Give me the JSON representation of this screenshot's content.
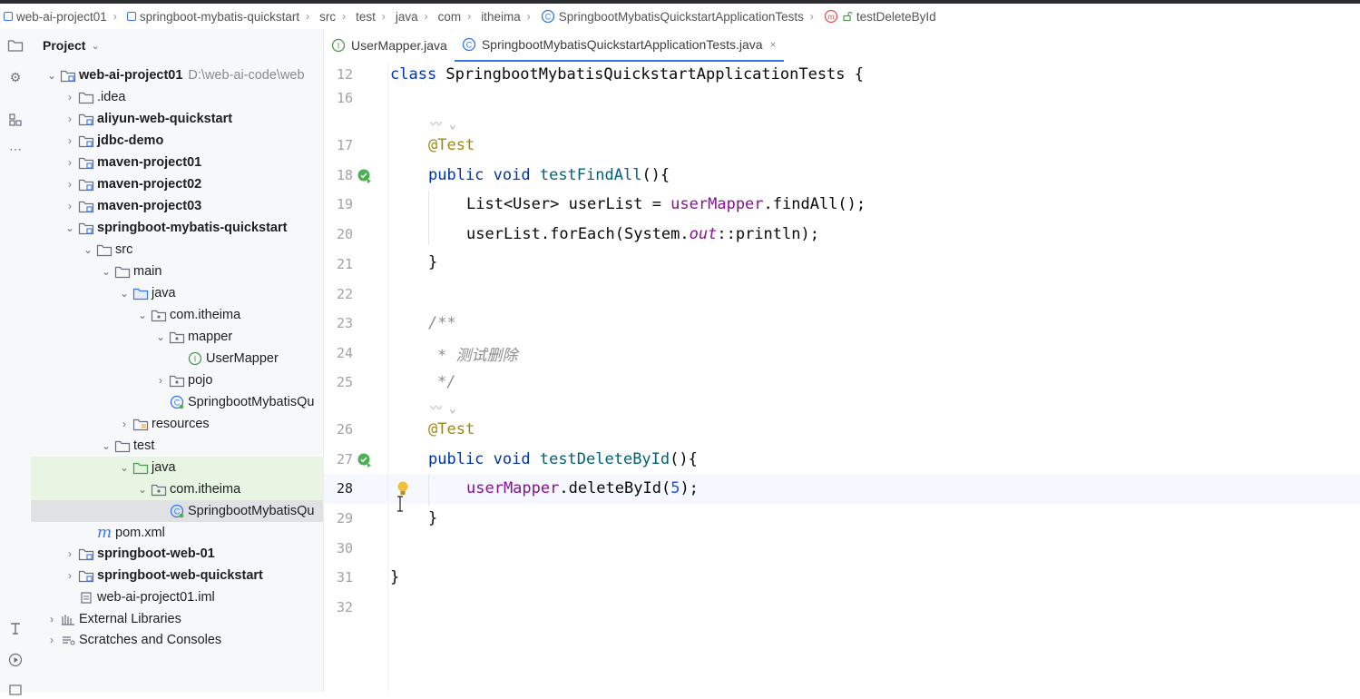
{
  "breadcrumb": [
    {
      "label": "web-ai-project01",
      "icon": "module-icon"
    },
    {
      "label": "springboot-mybatis-quickstart",
      "icon": "module-icon"
    },
    {
      "label": "src"
    },
    {
      "label": "test"
    },
    {
      "label": "java"
    },
    {
      "label": "com"
    },
    {
      "label": "itheima"
    },
    {
      "label": "SpringbootMybatisQuickstartApplicationTests",
      "icon": "class-icon"
    },
    {
      "label": "testDeleteById",
      "icon": "method-icon"
    }
  ],
  "panel": {
    "title": "Project"
  },
  "tree": [
    {
      "label": "web-ai-project01",
      "path": "D:\\web-ai-code\\web",
      "bold": true
    },
    {
      "label": ".idea"
    },
    {
      "label": "aliyun-web-quickstart",
      "bold": true
    },
    {
      "label": "jdbc-demo",
      "bold": true
    },
    {
      "label": "maven-project01",
      "bold": true
    },
    {
      "label": "maven-project02",
      "bold": true
    },
    {
      "label": "maven-project03",
      "bold": true
    },
    {
      "label": "springboot-mybatis-quickstart",
      "bold": true
    },
    {
      "label": "src"
    },
    {
      "label": "main"
    },
    {
      "label": "java"
    },
    {
      "label": "com.itheima"
    },
    {
      "label": "mapper"
    },
    {
      "label": "UserMapper"
    },
    {
      "label": "pojo"
    },
    {
      "label": "SpringbootMybatisQu"
    },
    {
      "label": "resources"
    },
    {
      "label": "test"
    },
    {
      "label": "java"
    },
    {
      "label": "com.itheima"
    },
    {
      "label": "SpringbootMybatisQu"
    },
    {
      "label": "pom.xml"
    },
    {
      "label": "springboot-web-01",
      "bold": true
    },
    {
      "label": "springboot-web-quickstart",
      "bold": true
    },
    {
      "label": "web-ai-project01.iml"
    },
    {
      "label": "External Libraries"
    },
    {
      "label": "Scratches and Consoles"
    }
  ],
  "tabs": [
    {
      "label": "UserMapper.java",
      "active": false
    },
    {
      "label": "SpringbootMybatisQuickstartApplicationTests.java",
      "active": true,
      "close": "×"
    }
  ],
  "line_numbers": [
    "12",
    "16",
    "17",
    "18",
    "19",
    "20",
    "21",
    "22",
    "23",
    "24",
    "25",
    "26",
    "27",
    "28",
    "29",
    "30",
    "31",
    "32"
  ],
  "code": {
    "l12": {
      "kw": "class",
      "rest": " SpringbootMybatisQuickstartApplicationTests {"
    },
    "hint": "〰 ⌄",
    "l17": "@Test",
    "l18": {
      "kw": "public void",
      "fn": "testFindAll",
      "rest": "(){"
    },
    "l19": {
      "a": "List<User> userList = ",
      "field": "userMapper",
      "b": ".findAll();"
    },
    "l20": {
      "a": "userList.forEach(System.",
      "static": "out",
      "b": "::println);"
    },
    "l21": "}",
    "l23": "/**",
    "l24": "* 测试删除",
    "l25": "*/",
    "l26": "@Test",
    "l27": {
      "kw": "public void",
      "fn": "testDeleteById",
      "rest": "(){"
    },
    "l28": {
      "field": "userMapper",
      "a": ".deleteById(",
      "num": "5",
      "b": ");"
    },
    "l29": "}",
    "l31": "}"
  },
  "colors": {
    "accent": "#3574f0",
    "keyword": "#0033b3",
    "annotation": "#9e880d",
    "run_icon": "#4caf50"
  }
}
